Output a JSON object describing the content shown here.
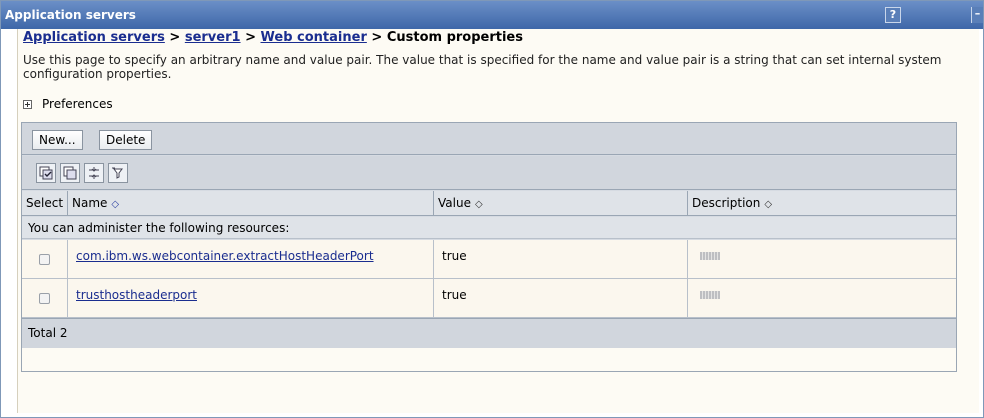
{
  "window": {
    "title": "Application servers",
    "help_label": "?",
    "min_label": "–"
  },
  "breadcrumb": {
    "items": [
      "Application servers",
      "server1",
      "Web container"
    ],
    "separator": ">",
    "current": "Custom properties"
  },
  "description": "Use this page to specify an arbitrary name and value pair. The value that is specified for the name and value pair is a string that can set internal system configuration properties.",
  "preferences": {
    "label": "Preferences"
  },
  "toolbar": {
    "new_label": "New...",
    "delete_label": "Delete",
    "icons": [
      "select-all-icon",
      "deselect-all-icon",
      "show-filter-icon",
      "clear-filter-icon"
    ]
  },
  "table": {
    "columns": {
      "select": "Select",
      "name": "Name",
      "value": "Value",
      "description": "Description"
    },
    "info_text": "You can administer the following resources:",
    "rows": [
      {
        "name": "com.ibm.ws.webcontainer.extractHostHeaderPort",
        "value": "true"
      },
      {
        "name": "trusthostheaderport",
        "value": "true"
      }
    ],
    "total": "Total 2"
  },
  "colors": {
    "title_bar": "#4a70b0",
    "link": "#1a2d8f",
    "row_background": "#fbf7ee",
    "header_background": "#dfe3e8"
  }
}
